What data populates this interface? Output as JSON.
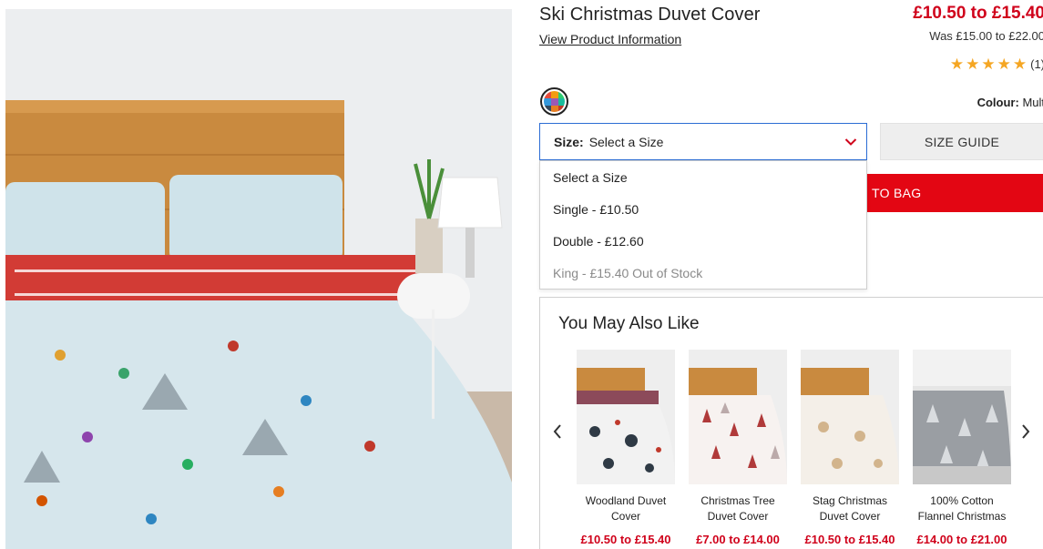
{
  "product": {
    "title": "Ski Christmas Duvet Cover",
    "view_info": "View Product Information",
    "price_now": "£10.50 to £15.40",
    "price_was": "Was £15.00 to £22.00",
    "rating_stars": 5,
    "rating_count": "(1)",
    "colour_label": "Colour:",
    "colour_value": "Mult"
  },
  "size": {
    "label": "Size:",
    "selected": "Select a Size",
    "guide_label": "SIZE GUIDE",
    "options": [
      {
        "label": "Select a Size",
        "available": true
      },
      {
        "label": "Single - £10.50",
        "available": true
      },
      {
        "label": "Double - £12.60",
        "available": true
      },
      {
        "label": "King - £15.40 Out of Stock",
        "available": false
      }
    ]
  },
  "cart": {
    "add_label": "TO BAG"
  },
  "recommendations": {
    "title": "You May Also Like",
    "items": [
      {
        "name": "Woodland Duvet Cover",
        "price": "£10.50 to £15.40"
      },
      {
        "name": "Christmas Tree Duvet Cover",
        "price": "£7.00 to £14.00"
      },
      {
        "name": "Stag Christmas Duvet Cover",
        "price": "£10.50 to £15.40"
      },
      {
        "name": "100% Cotton Flannel Christmas",
        "price": "£14.00 to £21.00"
      }
    ]
  },
  "colors": {
    "accent_red": "#e30613",
    "price_red": "#d0021b",
    "focus_blue": "#2b6cd4",
    "star": "#f5a623"
  },
  "icons": {
    "dropdown": "chevron-down-icon",
    "prev": "chevron-left-icon",
    "next": "chevron-right-icon",
    "rating": "star-icon"
  }
}
